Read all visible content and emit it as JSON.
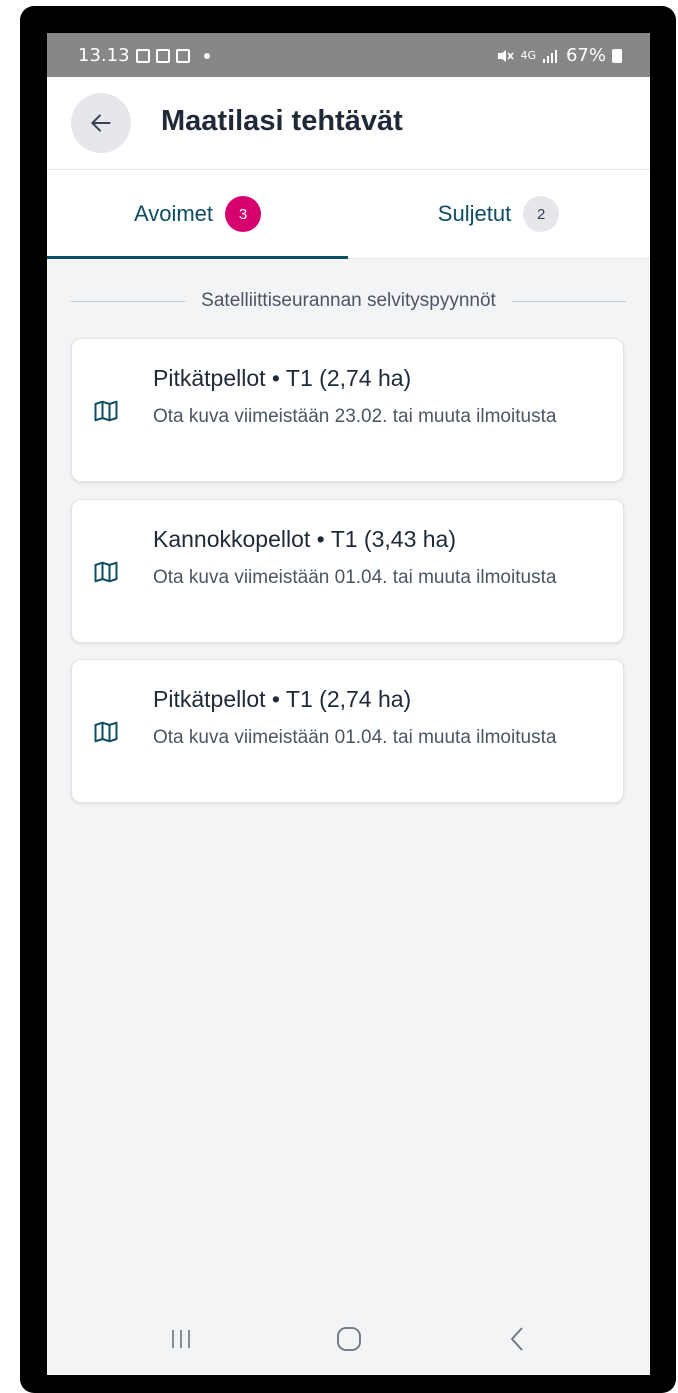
{
  "status_bar": {
    "time": "13.13",
    "network": "4G",
    "battery": "67%",
    "icons": [
      "image-icon",
      "calendar-icon",
      "cast-icon",
      "mute-icon",
      "signal-icon",
      "battery-icon"
    ]
  },
  "app_bar": {
    "title": "Maatilasi tehtävät",
    "back_icon": "arrow-left-icon"
  },
  "tabs": [
    {
      "label": "Avoimet",
      "count": "3",
      "active": true
    },
    {
      "label": "Suljetut",
      "count": "2",
      "active": false
    }
  ],
  "section": {
    "title": "Satelliittiseurannan selvityspyynnöt"
  },
  "tasks": [
    {
      "title": "Pitkätpellot • T1 (2,74 ha)",
      "description": "Ota kuva viimeistään 23.02. tai muuta ilmoitusta",
      "icon": "map-icon"
    },
    {
      "title": "Kannokkopellot • T1 (3,43 ha)",
      "description": "Ota kuva viimeistään 01.04. tai muuta ilmoitusta",
      "icon": "map-icon"
    },
    {
      "title": "Pitkätpellot • T1 (2,74 ha)",
      "description": "Ota kuva viimeistään 01.04. tai muuta ilmoitusta",
      "icon": "map-icon"
    }
  ],
  "colors": {
    "primary": "#0e4d62",
    "badge_active": "#d6006e",
    "background": "#f3f4f6"
  }
}
